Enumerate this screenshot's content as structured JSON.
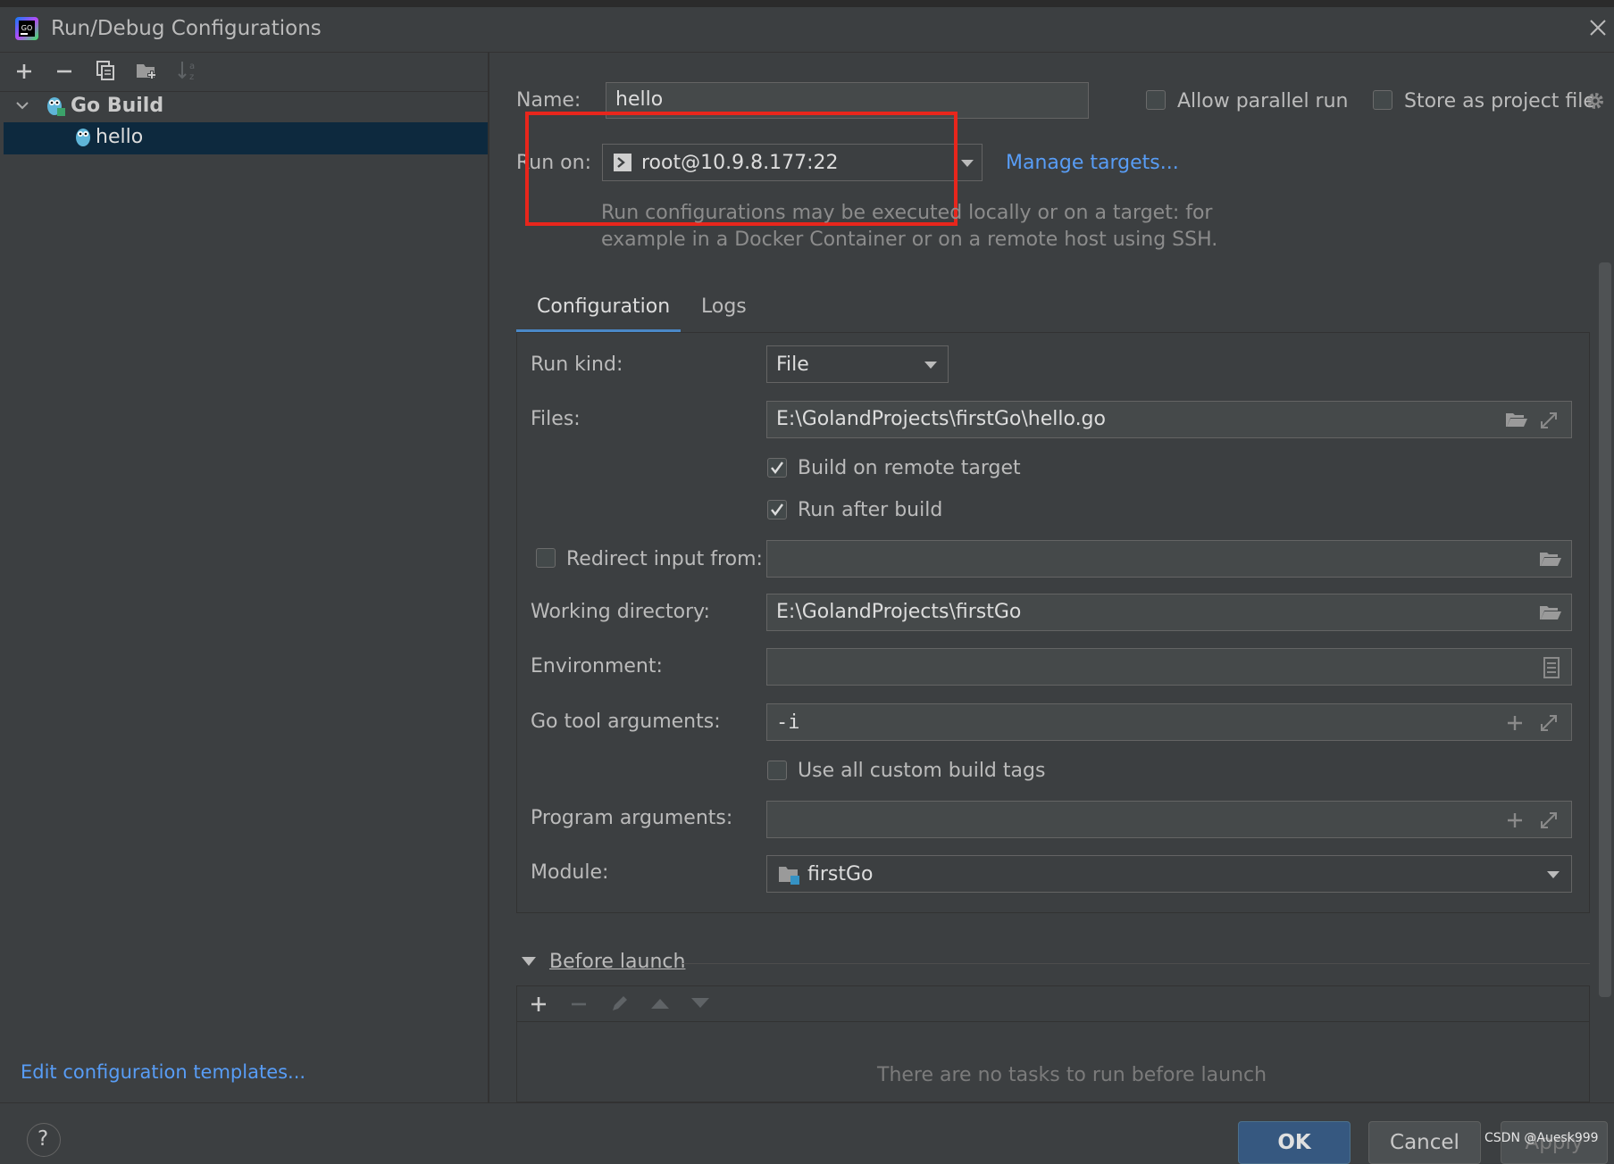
{
  "window": {
    "title": "Run/Debug Configurations",
    "app_icon": "goland-icon"
  },
  "left_toolbar": {
    "icons": [
      "add-icon",
      "remove-icon",
      "copy-icon",
      "new-folder-icon",
      "sort-icon"
    ]
  },
  "tree": {
    "group_label": "Go Build",
    "item_label": "hello"
  },
  "edit_templates_link": "Edit configuration templates...",
  "form": {
    "name_label": "Name:",
    "name_value": "hello",
    "allow_parallel_label": "Allow parallel run",
    "store_as_project_label": "Store as project file",
    "run_on_label": "Run on:",
    "run_on_value": "root@10.9.8.177:22",
    "manage_targets_link": "Manage targets...",
    "run_on_hint_line1": "Run configurations may be executed locally or on a target: for",
    "run_on_hint_line2": "example in a Docker Container or on a remote host using SSH."
  },
  "tabs": [
    {
      "label": "Configuration",
      "active": true
    },
    {
      "label": "Logs",
      "active": false
    }
  ],
  "config": {
    "run_kind_label": "Run kind:",
    "run_kind_value": "File",
    "files_label": "Files:",
    "files_value": "E:\\GolandProjects\\firstGo\\hello.go",
    "build_on_remote_label": "Build on remote target",
    "build_on_remote_checked": true,
    "run_after_build_label": "Run after build",
    "run_after_build_checked": true,
    "redirect_input_label": "Redirect input from:",
    "redirect_input_checked": false,
    "redirect_input_value": "",
    "working_dir_label": "Working directory:",
    "working_dir_value": "E:\\GolandProjects\\firstGo",
    "environment_label": "Environment:",
    "environment_value": "",
    "go_tool_args_label": "Go tool arguments:",
    "go_tool_args_value": "-i",
    "custom_build_tags_label": "Use all custom build tags",
    "custom_build_tags_checked": false,
    "program_args_label": "Program arguments:",
    "program_args_value": "",
    "module_label": "Module:",
    "module_value": "firstGo"
  },
  "before_launch": {
    "label": "Before launch",
    "empty_text": "There are no tasks to run before launch"
  },
  "buttons": {
    "ok": "OK",
    "cancel": "Cancel",
    "apply": "Apply"
  },
  "watermark": "CSDN @Auesk999",
  "colors": {
    "background": "#3c3f41",
    "field": "#45494a",
    "selection": "#0d293e",
    "link": "#589df6",
    "tab_underline": "#4a88c7",
    "ok_button": "#365880",
    "highlight_box": "#e8261c"
  }
}
